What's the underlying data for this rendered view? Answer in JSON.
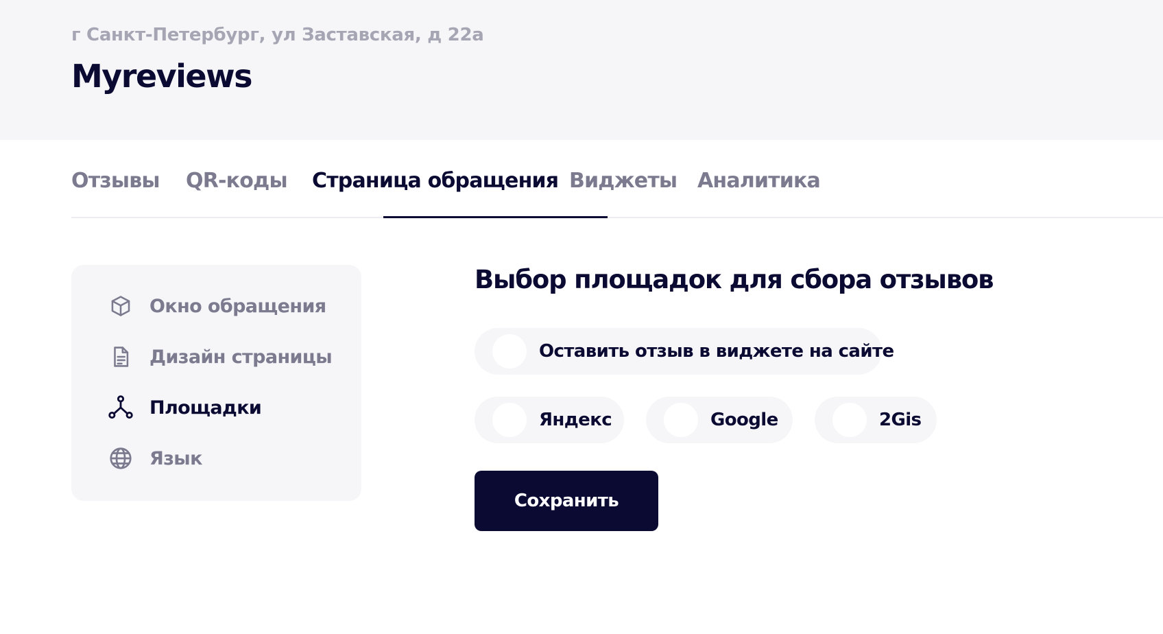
{
  "header": {
    "address": "г Санкт-Петербург, ул Заставская, д 22а",
    "company_name": "Myreviews"
  },
  "tabs": [
    {
      "label": "Отзывы",
      "active": false
    },
    {
      "label": "QR-коды",
      "active": false
    },
    {
      "label": "Страница обращения",
      "active": true
    },
    {
      "label": "Виджеты",
      "active": false
    },
    {
      "label": "Аналитика",
      "active": false
    }
  ],
  "sidebar": {
    "items": [
      {
        "label": "Окно обращения",
        "icon": "cube-icon",
        "active": false
      },
      {
        "label": "Дизайн страницы",
        "icon": "document-icon",
        "active": false
      },
      {
        "label": "Площадки",
        "icon": "network-icon",
        "active": true
      },
      {
        "label": "Язык",
        "icon": "globe-icon",
        "active": false
      }
    ]
  },
  "main": {
    "title": "Выбор площадок для сбора отзывов",
    "options": [
      {
        "label": "Оставить отзыв в виджете на сайте",
        "enabled": false
      },
      {
        "label": "Яндекс",
        "enabled": false
      },
      {
        "label": "Google",
        "enabled": false
      },
      {
        "label": "2Gis",
        "enabled": false
      }
    ],
    "save_label": "Сохранить"
  },
  "colors": {
    "primary": "#0b0a33",
    "muted_text": "#7b7a8f",
    "address_text": "#a6a5b3",
    "panel_background": "#f6f6f9"
  }
}
